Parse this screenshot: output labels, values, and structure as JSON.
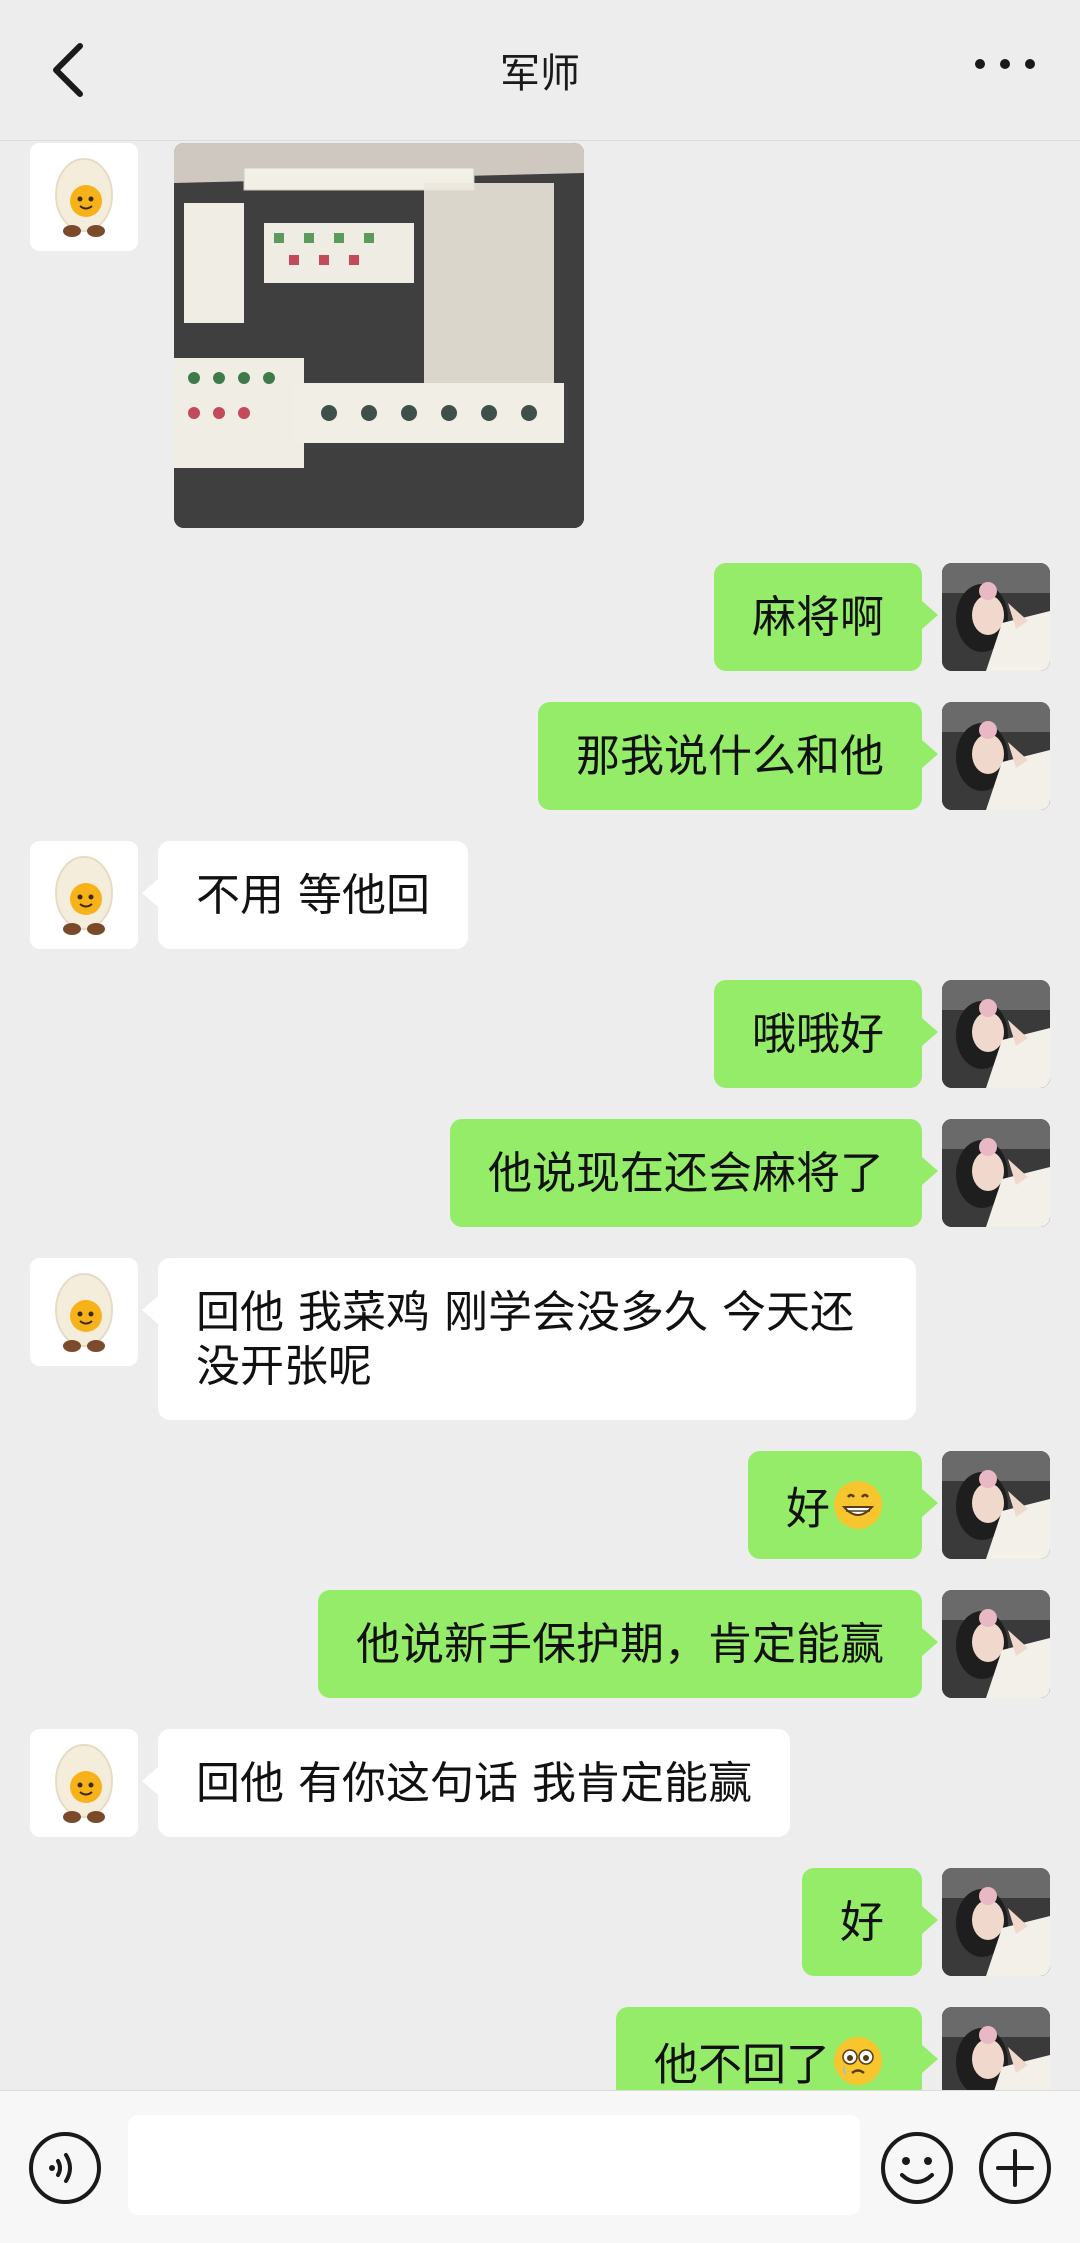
{
  "header": {
    "title": "军师",
    "back_icon": "chevron-left-icon",
    "more_icon": "more-dots-icon"
  },
  "messages": [
    {
      "side": "left",
      "type": "image",
      "image": "mahjong-table-photo"
    },
    {
      "side": "right",
      "type": "text",
      "text": "麻将啊"
    },
    {
      "side": "right",
      "type": "text",
      "text": "那我说什么和他"
    },
    {
      "side": "left",
      "type": "text",
      "text": "不用 等他回"
    },
    {
      "side": "right",
      "type": "text",
      "text": "哦哦好"
    },
    {
      "side": "right",
      "type": "text",
      "text": "他说现在还会麻将了"
    },
    {
      "side": "left",
      "type": "text",
      "text": "回他 我菜鸡 刚学会没多久 今天还没开张呢"
    },
    {
      "side": "right",
      "type": "text",
      "text": "好",
      "emoji": "grinning-face-emoji"
    },
    {
      "side": "right",
      "type": "text",
      "text": "他说新手保护期，肯定能赢"
    },
    {
      "side": "left",
      "type": "text",
      "text": "回他 有你这句话 我肯定能赢"
    },
    {
      "side": "right",
      "type": "text",
      "text": "好"
    },
    {
      "side": "right",
      "type": "text",
      "text": "他不回了",
      "emoji": "crying-face-emoji"
    }
  ],
  "footer": {
    "voice_icon": "voice-icon",
    "input_value": "",
    "emoji_icon": "emoji-icon",
    "plus_icon": "plus-icon"
  },
  "colors": {
    "background": "#ededed",
    "bubble_self": "#95ec69",
    "bubble_other": "#ffffff"
  }
}
